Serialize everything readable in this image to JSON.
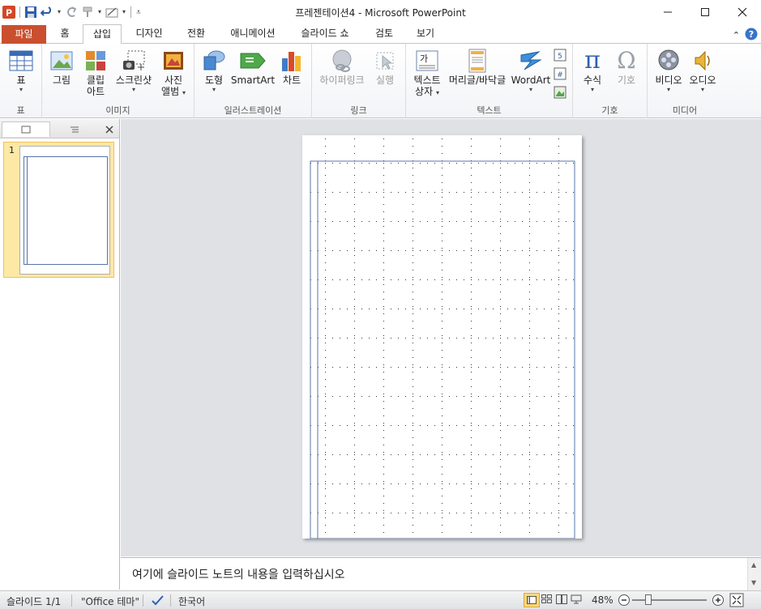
{
  "window": {
    "title": "프레젠테이션4 - Microsoft PowerPoint",
    "controls": [
      "minimize",
      "maximize",
      "close"
    ]
  },
  "quick_access": {
    "icons": [
      "powerpoint-icon",
      "save-icon",
      "undo-icon",
      "redo-icon",
      "format-painter-icon",
      "draw-table-icon",
      "customize-icon"
    ]
  },
  "tabs": [
    {
      "label": "파일"
    },
    {
      "label": "홈"
    },
    {
      "label": "삽입"
    },
    {
      "label": "디자인"
    },
    {
      "label": "전환"
    },
    {
      "label": "애니메이션"
    },
    {
      "label": "슬라이드 쇼"
    },
    {
      "label": "검토"
    },
    {
      "label": "보기"
    }
  ],
  "active_tab": "삽입",
  "ribbon": {
    "groups": {
      "table": "표",
      "images": "이미지",
      "illustrations": "일러스트레이션",
      "links": "링크",
      "text": "텍스트",
      "symbols": "기호",
      "media": "미디어"
    },
    "buttons": {
      "table": "표",
      "picture": "그림",
      "clipart_1": "클립",
      "clipart_2": "아트",
      "screenshot": "스크린샷",
      "photo_album_1": "사진",
      "photo_album_2": "앨범",
      "shapes": "도형",
      "smartart": "SmartArt",
      "chart": "차트",
      "hyperlink": "하이퍼링크",
      "action": "실행",
      "textbox_1": "텍스트",
      "textbox_2": "상자",
      "header_footer": "머리글/바닥글",
      "wordart": "WordArt",
      "equation": "수식",
      "symbol": "기호",
      "video": "비디오",
      "audio": "오디오"
    },
    "textbox_glyph": "가"
  },
  "slides_panel": {
    "slide_number": "1"
  },
  "notes": {
    "placeholder": "여기에 슬라이드 노트의 내용을 입력하십시오"
  },
  "status": {
    "slide_info": "슬라이드 1/1",
    "theme": "\"Office 테마\"",
    "language": "한국어",
    "zoom": "48%"
  },
  "colors": {
    "file_tab": "#c94f2f",
    "editor_bg": "#dfe1e5",
    "slide_guide": "#5874a8",
    "thumb_highlight": "#fde8a6"
  }
}
